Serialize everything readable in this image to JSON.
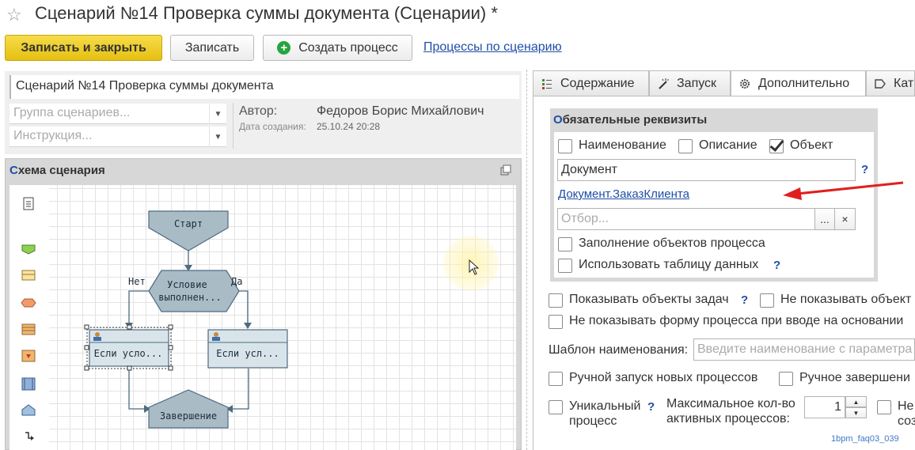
{
  "window": {
    "title": "Сценарий №14 Проверка суммы документа (Сценарии) *"
  },
  "toolbar": {
    "save_close_label": "Записать и закрыть",
    "save_label": "Записать",
    "create_process_label": "Создать процесс",
    "processes_link": "Процессы по сценарию"
  },
  "scenario": {
    "name_value": "Сценарий №14 Проверка суммы документа",
    "group_placeholder": "Группа сценариев...",
    "instruction_placeholder": "Инструкция...",
    "author_label": "Автор:",
    "author_value": "Федоров Борис Михайлович",
    "created_label": "Дата создания:",
    "created_value": "25.10.24 20:28"
  },
  "schema": {
    "title": "Схема сценария",
    "nodes": {
      "start": "Старт",
      "condition": "Условие выполнен...",
      "left_task": "Если усло...",
      "right_task": "Если усл...",
      "end": "Завершение"
    },
    "edge_no": "Нет",
    "edge_yes": "Да"
  },
  "tabs": [
    {
      "label": "Содержание",
      "icon": "content-icon"
    },
    {
      "label": "Запуск",
      "icon": "wand-icon"
    },
    {
      "label": "Дополнительно",
      "icon": "gear-icon"
    },
    {
      "label": "Кат",
      "icon": "category-icon"
    }
  ],
  "required": {
    "title": "Обязательные реквизиты",
    "cb_name": "Наименование",
    "cb_description": "Описание",
    "cb_object": "Объект",
    "object_value": "Документ",
    "object_link": "Документ.ЗаказКлиента",
    "filter_placeholder": "Отбор...",
    "filter_more": "...",
    "filter_clear": "×",
    "cb_fill_objects": "Заполнение объектов процесса",
    "cb_use_table": "Использовать таблицу данных",
    "help": "?"
  },
  "options": {
    "show_task_objects": "Показывать объекты задач",
    "hide_objects": "Не показывать объект",
    "hide_process_form": "Не показывать форму процесса при вводе на основании",
    "name_template_label": "Шаблон наименования:",
    "name_template_placeholder": "Введите наименование с параметра",
    "manual_start": "Ручной запуск новых процессов",
    "manual_finish": "Ручное завершени",
    "unique_line1": "Уникальный",
    "unique_line2": "процесс",
    "max_label_line1": "Максимальное кол-во",
    "max_label_line2": "активных процессов:",
    "max_value": "1",
    "cut_line1": "Не",
    "cut_line2": "соз"
  },
  "watermark": "1bpm_faq03_039",
  "colors": {
    "accent_button": "#f0cf2a",
    "link": "#1f4ea7",
    "node_fill": "#a9bcc6",
    "node_stroke": "#4e6b80",
    "annotation_arrow": "#e02020"
  }
}
